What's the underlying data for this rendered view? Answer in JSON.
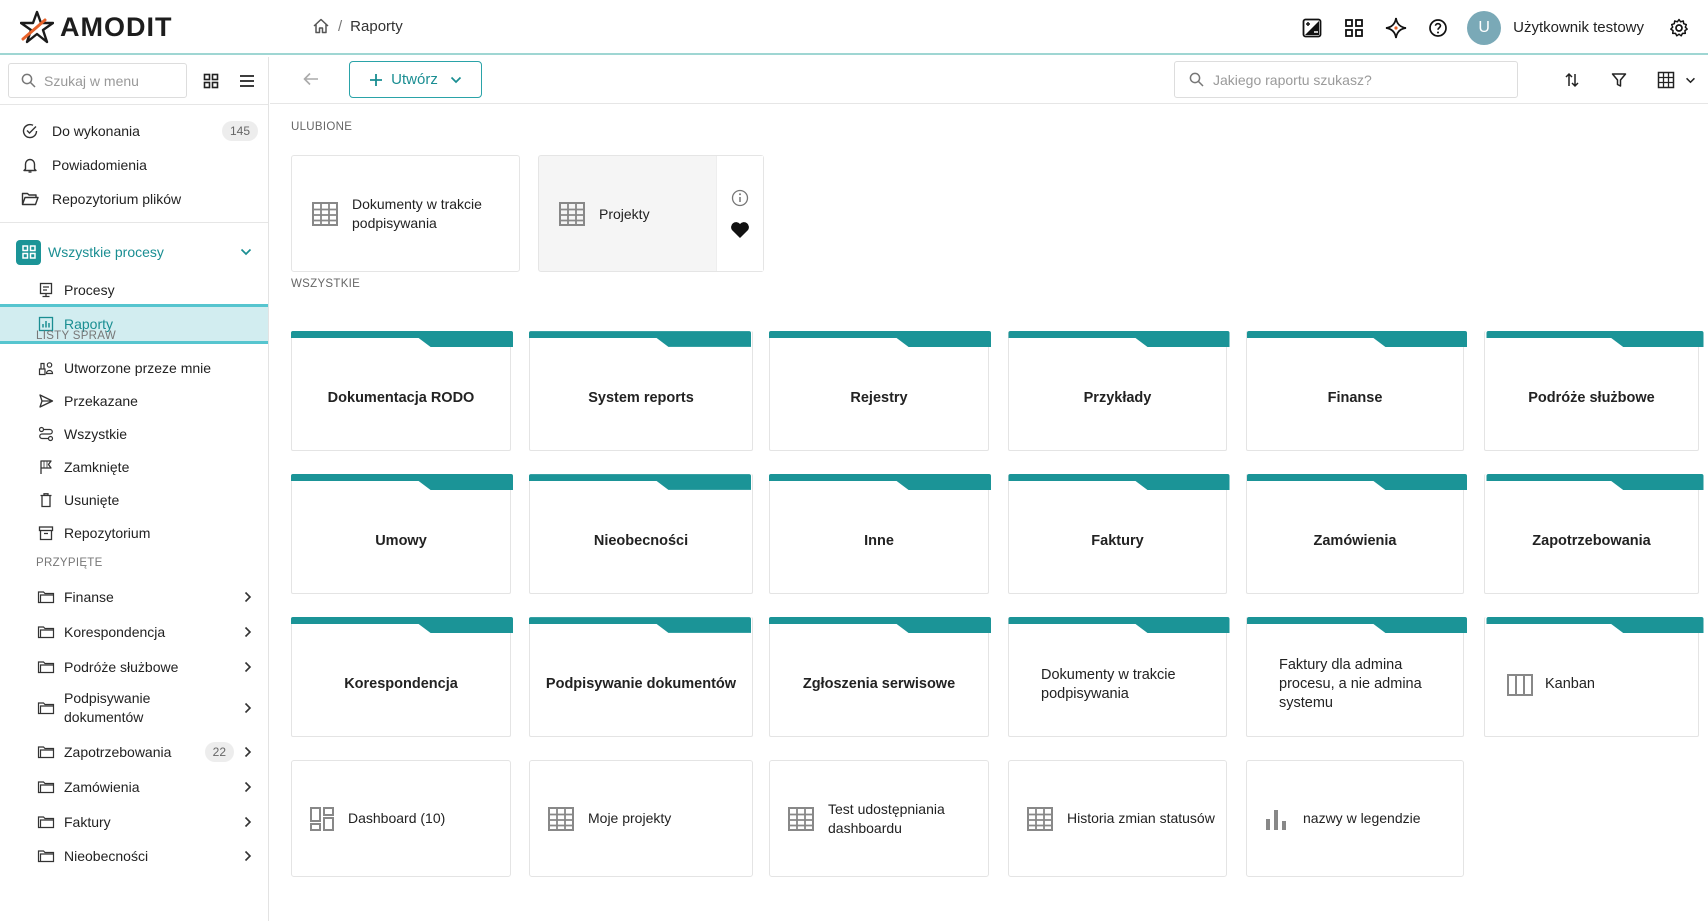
{
  "app": {
    "logo_text": "AMODIT"
  },
  "breadcrumb": {
    "current": "Raporty"
  },
  "user": {
    "initial": "U",
    "name": "Użytkownik testowy"
  },
  "sidebar": {
    "search_placeholder": "Szukaj w menu",
    "top_items": [
      {
        "label": "Do wykonania",
        "badge": "145"
      },
      {
        "label": "Powiadomienia"
      },
      {
        "label": "Repozytorium plików"
      }
    ],
    "all_processes": "Wszystkie procesy",
    "process_items": [
      {
        "label": "Procesy"
      },
      {
        "label": "Raporty"
      }
    ],
    "lists_label": "LISTY SPRAW",
    "list_items": [
      {
        "label": "Utworzone przeze mnie"
      },
      {
        "label": "Przekazane"
      },
      {
        "label": "Wszystkie"
      },
      {
        "label": "Zamknięte"
      },
      {
        "label": "Usunięte"
      },
      {
        "label": "Repozytorium"
      }
    ],
    "pinned_label": "PRZYPIĘTE",
    "pinned_items": [
      {
        "label": "Finanse"
      },
      {
        "label": "Korespondencja"
      },
      {
        "label": "Podróże służbowe"
      },
      {
        "label": "Podpisywanie",
        "label2": "dokumentów"
      },
      {
        "label": "Zapotrzebowania",
        "badge": "22"
      },
      {
        "label": "Zamówienia"
      },
      {
        "label": "Faktury"
      },
      {
        "label": "Nieobecności"
      }
    ]
  },
  "toolbar": {
    "create_label": "Utwórz",
    "search_placeholder": "Jakiego raportu szukasz?"
  },
  "favorites": {
    "label": "ULUBIONE",
    "items": [
      {
        "line1": "Dokumenty w trakcie",
        "line2": "podpisywania"
      },
      {
        "line1": "Projekty"
      }
    ]
  },
  "all": {
    "label": "WSZYSTKIE",
    "folders": [
      "Dokumentacja RODO",
      "System reports",
      "Rejestry",
      "Przykłady",
      "Finanse",
      "Podróże służbowe",
      "Umowy",
      "Nieobecności",
      "Inne",
      "Faktury",
      "Zamówienia",
      "Zapotrzebowania",
      "Korespondencja",
      "Podpisywanie dokumentów",
      "Zgłoszenia serwisowe"
    ],
    "folder_multiline": [
      {
        "line1": "Dokumenty w trakcie",
        "line2": "podpisywania"
      },
      {
        "line1": "Faktury dla admina",
        "line2": "procesu, a nie admina",
        "line3": "systemu"
      }
    ],
    "kanban": "Kanban",
    "reports": [
      {
        "line1": "Dashboard (10)",
        "icon": "dashboard-icon"
      },
      {
        "line1": "Moje projekty",
        "icon": "table-icon"
      },
      {
        "line1": "Test udostępniania",
        "line2": "dashboardu",
        "icon": "table-icon"
      },
      {
        "line1": "Historia zmian statusów",
        "icon": "table-icon"
      },
      {
        "line1": "nazwy w legendzie",
        "icon": "bar-chart-icon"
      }
    ]
  },
  "colors": {
    "accent": "#1a8e92",
    "folder_tab": "#1b9497",
    "active_bg": "#d2edf0"
  }
}
